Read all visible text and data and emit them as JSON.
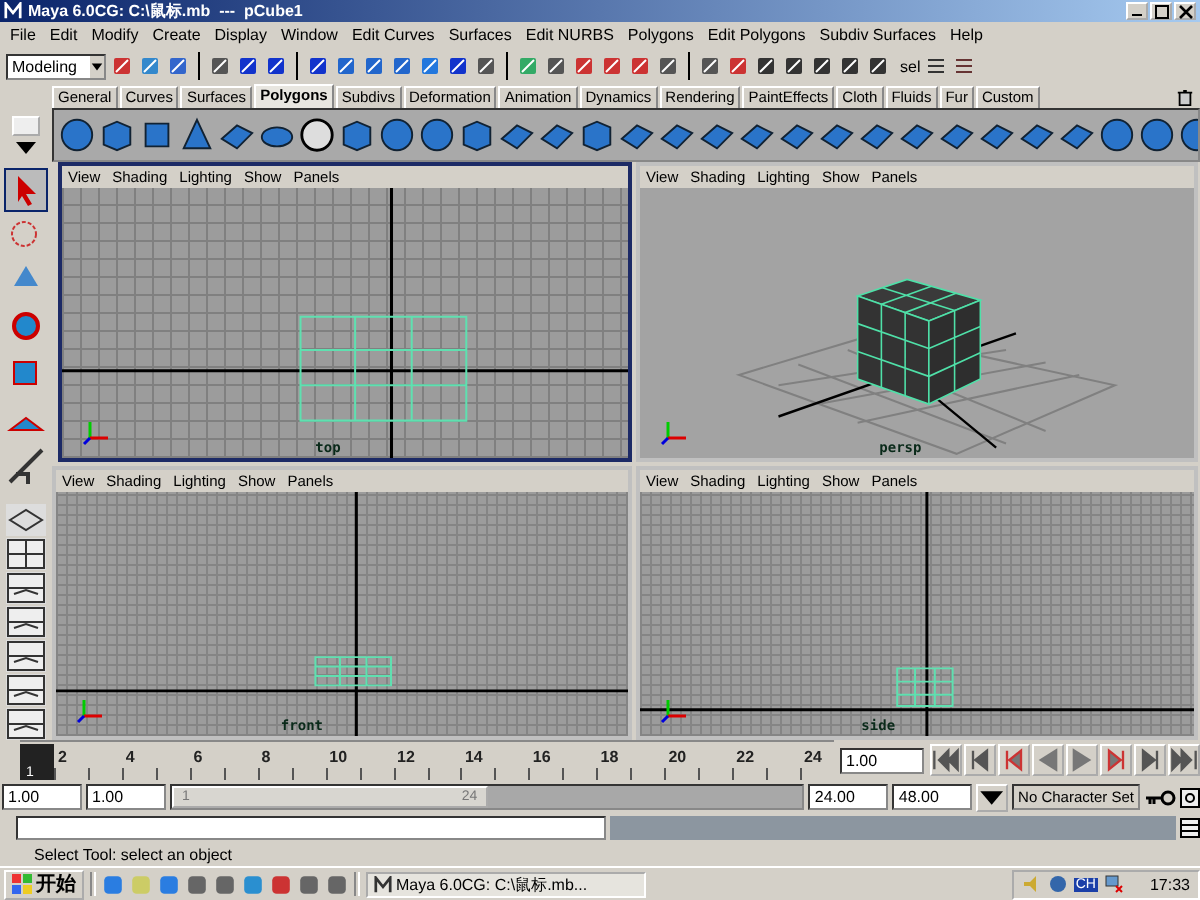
{
  "window": {
    "title": "Maya 6.0CG: C:\\鼠标.mb  ---  pCube1"
  },
  "menu": [
    "File",
    "Edit",
    "Modify",
    "Create",
    "Display",
    "Window",
    "Edit Curves",
    "Surfaces",
    "Edit NURBS",
    "Polygons",
    "Edit Polygons",
    "Subdiv Surfaces",
    "Help"
  ],
  "status_line": {
    "mode": "Modeling",
    "sel_label": "sel"
  },
  "shelf": {
    "tabs": [
      {
        "label": "General",
        "selected": false
      },
      {
        "label": "Curves",
        "selected": false
      },
      {
        "label": "Surfaces",
        "selected": false
      },
      {
        "label": "Polygons",
        "selected": true
      },
      {
        "label": "Subdivs",
        "selected": false
      },
      {
        "label": "Deformation",
        "selected": false
      },
      {
        "label": "Animation",
        "selected": false
      },
      {
        "label": "Dynamics",
        "selected": false
      },
      {
        "label": "Rendering",
        "selected": false
      },
      {
        "label": "PaintEffects",
        "selected": false
      },
      {
        "label": "Cloth",
        "selected": false
      },
      {
        "label": "Fluids",
        "selected": false
      },
      {
        "label": "Fur",
        "selected": false
      },
      {
        "label": "Custom",
        "selected": false
      }
    ]
  },
  "viewports": [
    {
      "kind": "top",
      "label": "top",
      "selected": true,
      "menu": [
        "View",
        "Shading",
        "Lighting",
        "Show",
        "Panels"
      ]
    },
    {
      "kind": "persp",
      "label": "persp",
      "selected": false,
      "menu": [
        "View",
        "Shading",
        "Lighting",
        "Show",
        "Panels"
      ]
    },
    {
      "kind": "front",
      "label": "front",
      "selected": false,
      "menu": [
        "View",
        "Shading",
        "Lighting",
        "Show",
        "Panels"
      ]
    },
    {
      "kind": "side",
      "label": "side",
      "selected": false,
      "menu": [
        "View",
        "Shading",
        "Lighting",
        "Show",
        "Panels"
      ]
    }
  ],
  "time_slider": {
    "current": "1",
    "level": 0,
    "ticks": [
      "2",
      "4",
      "6",
      "8",
      "10",
      "12",
      "14",
      "16",
      "18",
      "20",
      "22",
      "24"
    ],
    "current_frame": "1.00"
  },
  "range_slider": {
    "start": "1.00",
    "range_start": "1.00",
    "thumb_start": "1",
    "thumb_end": "24",
    "level": 0.5,
    "range_end": "24.00",
    "end": "48.00",
    "character_set": "No Character Set"
  },
  "help_line": "Select Tool: select an object",
  "taskbar": {
    "start": "开始",
    "task": "Maya 6.0CG: C:\\鼠标.mb...",
    "ime": "CH",
    "clock": "17:33"
  }
}
